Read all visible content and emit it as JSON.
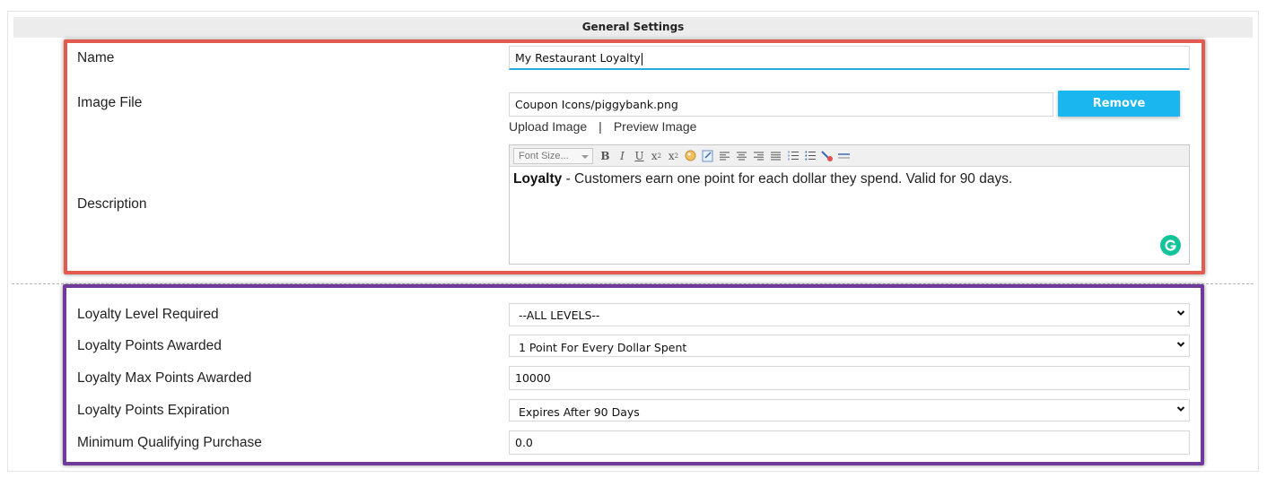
{
  "header": {
    "title": "General Settings"
  },
  "general": {
    "name_label": "Name",
    "name_value": "My Restaurant Loyalty",
    "image_label": "Image File",
    "image_value": "Coupon Icons/piggybank.png",
    "remove_label": "Remove",
    "upload_label": "Upload Image",
    "separator": "|",
    "preview_label": "Preview Image",
    "description_label": "Description",
    "editor": {
      "font_size_placeholder": "Font Size...",
      "tools": [
        "bold-icon",
        "italic-icon",
        "underline-icon",
        "subscript-icon",
        "superscript-icon",
        "image-icon",
        "link-icon",
        "align-left-icon",
        "align-center-icon",
        "align-right-icon",
        "align-justify-icon",
        "ordered-list-icon",
        "unordered-list-icon",
        "clean-format-icon",
        "horizontal-rule-icon"
      ],
      "bold_text": "Loyalty",
      "body_text": " - Customers earn one point for each dollar they spend. Valid for 90 days."
    }
  },
  "loyalty": {
    "level_label": "Loyalty Level Required",
    "level_value": "--ALL LEVELS--",
    "points_label": "Loyalty Points Awarded",
    "points_value": "1 Point For Every Dollar Spent",
    "max_label": "Loyalty Max Points Awarded",
    "max_value": "10000",
    "expiration_label": "Loyalty Points Expiration",
    "expiration_value": "Expires After 90 Days",
    "min_label": "Minimum Qualifying Purchase",
    "min_value": "0.0"
  },
  "colors": {
    "highlight_red": "#e35a4f",
    "highlight_purple": "#6f3a9a",
    "button_blue": "#1ab6f0",
    "focus_underline": "#29abe2",
    "grammarly_green": "#15c39a"
  }
}
